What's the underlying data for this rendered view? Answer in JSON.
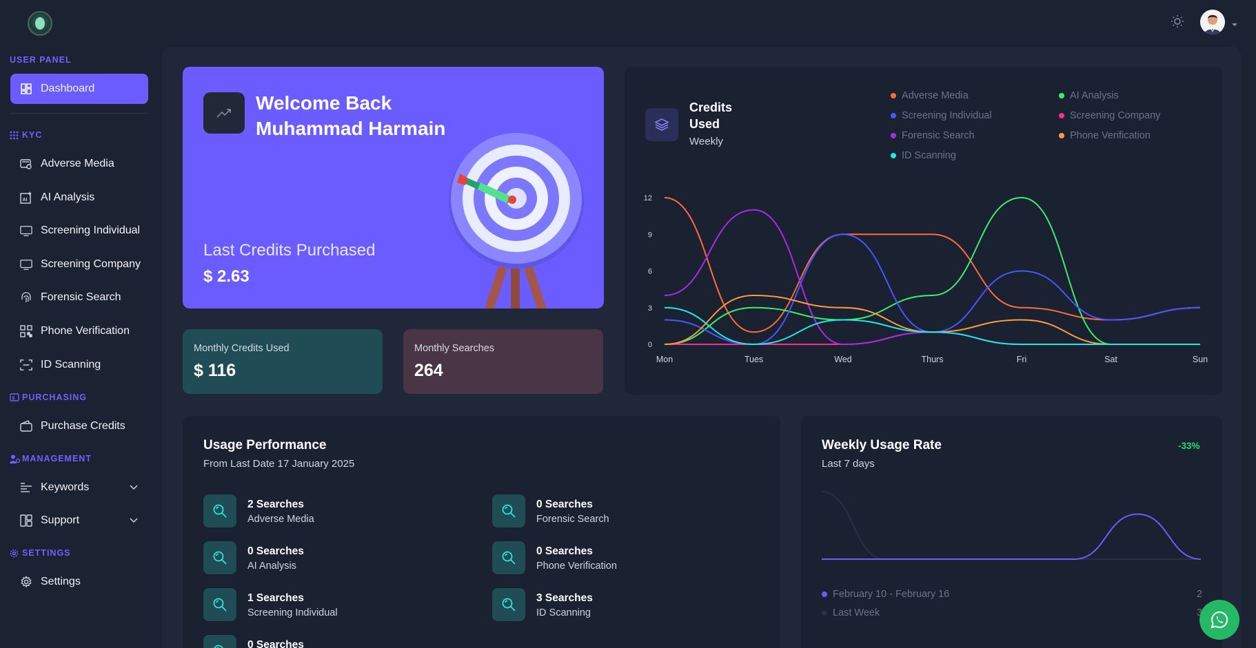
{
  "sidebar": {
    "sections": {
      "user_panel": "USER PANEL",
      "kyc": "KYC",
      "purchasing": "PURCHASING",
      "management": "MANAGEMENT",
      "settings": "SETTINGS"
    },
    "items": {
      "dashboard": "Dashboard",
      "adverse_media": "Adverse Media",
      "ai_analysis": "AI Analysis",
      "screening_individual": "Screening Individual",
      "screening_company": "Screening Company",
      "forensic_search": "Forensic Search",
      "phone_verification": "Phone Verification",
      "id_scanning": "ID Scanning",
      "purchase_credits": "Purchase Credits",
      "keywords": "Keywords",
      "support": "Support",
      "settings": "Settings"
    }
  },
  "welcome": {
    "line1": "Welcome Back",
    "line2": "Muhammad Harmain",
    "last_credits_label": "Last Credits Purchased",
    "last_credits_value": "$ 2.63"
  },
  "stats": {
    "monthly_credits_label": "Monthly Credits Used",
    "monthly_credits_value": "$ 116",
    "monthly_searches_label": "Monthly Searches",
    "monthly_searches_value": "264"
  },
  "credits": {
    "title_line1": "Credits",
    "title_line2": "Used",
    "subtitle": "Weekly"
  },
  "chart_data": {
    "type": "line",
    "categories": [
      "Mon",
      "Tues",
      "Wed",
      "Thurs",
      "Fri",
      "Sat",
      "Sun"
    ],
    "ylim": [
      0,
      12
    ],
    "yticks": [
      0,
      3,
      6,
      9,
      12
    ],
    "legend_position": "top-right",
    "series": [
      {
        "name": "Adverse Media",
        "color": "#ff6a3d",
        "values": [
          12,
          1,
          9,
          9,
          3,
          2,
          3
        ]
      },
      {
        "name": "AI Analysis",
        "color": "#39f06a",
        "values": [
          0,
          3,
          2,
          4,
          12,
          0,
          0
        ]
      },
      {
        "name": "Screening Individual",
        "color": "#4b55ff",
        "values": [
          2,
          0,
          9,
          1,
          6,
          2,
          3
        ]
      },
      {
        "name": "Screening Company",
        "color": "#ff2d8a",
        "values": [
          0,
          0,
          0,
          1,
          0,
          0,
          0
        ]
      },
      {
        "name": "Forensic Search",
        "color": "#a72be3",
        "values": [
          4,
          11,
          0,
          1,
          0,
          0,
          0
        ]
      },
      {
        "name": "Phone Verification",
        "color": "#ff9a3d",
        "values": [
          0,
          4,
          3,
          1,
          2,
          0,
          0
        ]
      },
      {
        "name": "ID Scanning",
        "color": "#22e6e0",
        "values": [
          3,
          0,
          2,
          1,
          0,
          0,
          0
        ]
      }
    ]
  },
  "usage": {
    "title": "Usage Performance",
    "subtitle": "From Last Date 17 January 2025",
    "items": [
      {
        "count": "2 Searches",
        "label": "Adverse Media"
      },
      {
        "count": "0 Searches",
        "label": "Forensic Search"
      },
      {
        "count": "0 Searches",
        "label": "AI Analysis"
      },
      {
        "count": "0 Searches",
        "label": "Phone Verification"
      },
      {
        "count": "1 Searches",
        "label": "Screening Individual"
      },
      {
        "count": "3 Searches",
        "label": "ID Scanning"
      },
      {
        "count": "0 Searches",
        "label": ""
      }
    ]
  },
  "weekly": {
    "title": "Weekly Usage Rate",
    "subtitle": "Last 7 days",
    "change": "-33%",
    "legend": [
      {
        "label": "February 10 - February 16",
        "value": "2",
        "color": "#6b5cff"
      },
      {
        "label": "Last Week",
        "value": "3",
        "color": "#2a3146"
      }
    ],
    "current_week": [
      0,
      0,
      0,
      0,
      0,
      2,
      0
    ],
    "last_week": [
      3,
      0,
      0,
      0,
      0,
      0,
      0
    ]
  }
}
